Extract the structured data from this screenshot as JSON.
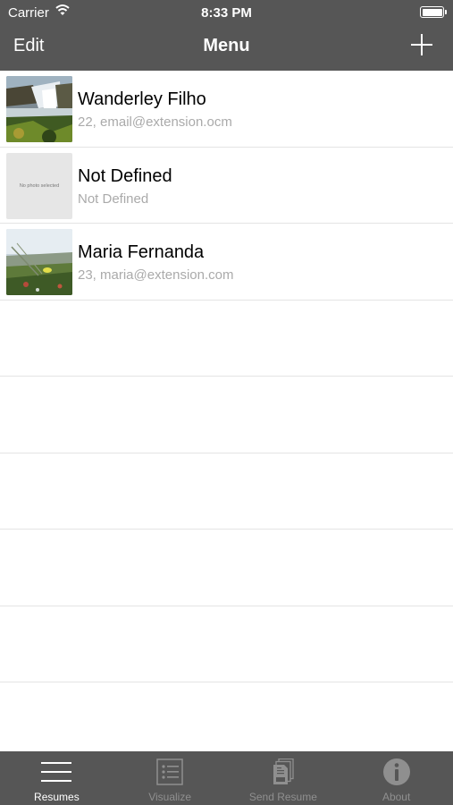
{
  "status_bar": {
    "carrier": "Carrier",
    "time": "8:33 PM"
  },
  "nav": {
    "edit_label": "Edit",
    "title": "Menu",
    "add_icon": "plus-icon"
  },
  "resumes": [
    {
      "name": "Wanderley Filho",
      "detail": "22, email@extension.ocm",
      "photo": "waterfall-photo"
    },
    {
      "name": "Not Defined",
      "detail": "Not Defined",
      "photo_placeholder": "No photo selected"
    },
    {
      "name": "Maria Fernanda",
      "detail": "23, maria@extension.com",
      "photo": "flowers-photo"
    }
  ],
  "tabs": [
    {
      "label": "Resumes",
      "icon": "hamburger-icon",
      "active": true
    },
    {
      "label": "Visualize",
      "icon": "list-icon",
      "active": false
    },
    {
      "label": "Send Resume",
      "icon": "pdf-icon",
      "active": false
    },
    {
      "label": "About",
      "icon": "info-icon",
      "active": false
    }
  ],
  "colors": {
    "bar": "#565656",
    "active_tab": "#ffffff",
    "inactive_tab": "#8f8f8f",
    "subtitle": "#aaaaaa"
  }
}
